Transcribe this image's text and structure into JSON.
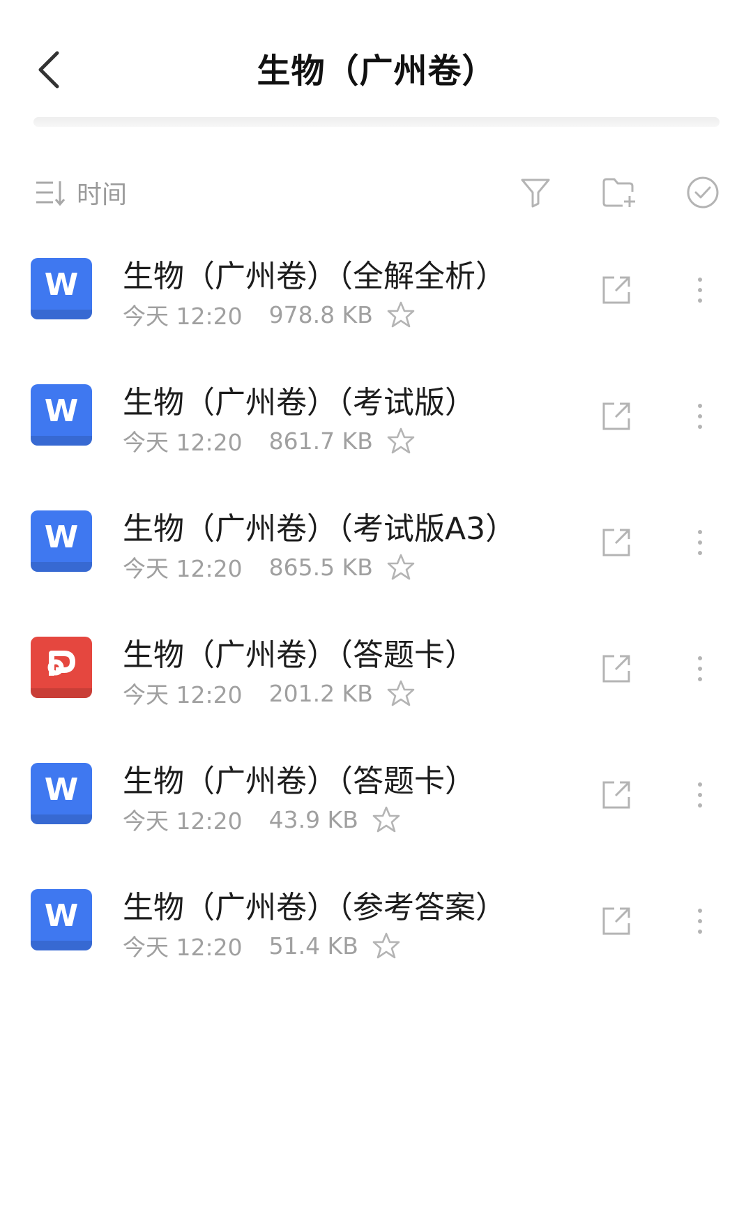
{
  "header": {
    "title": "生物（广州卷）"
  },
  "toolbar": {
    "sort_label": "时间"
  },
  "files": [
    {
      "type": "word",
      "name": "生物（广州卷）（全解全析）",
      "date": "今天 12:20",
      "size": "978.8 KB"
    },
    {
      "type": "word",
      "name": "生物（广州卷）（考试版）",
      "date": "今天 12:20",
      "size": "861.7 KB"
    },
    {
      "type": "word",
      "name": "生物（广州卷）（考试版A3）",
      "date": "今天 12:20",
      "size": "865.5 KB"
    },
    {
      "type": "ppt",
      "name": "生物（广州卷）（答题卡）",
      "date": "今天 12:20",
      "size": "201.2 KB"
    },
    {
      "type": "word",
      "name": "生物（广州卷）（答题卡）",
      "date": "今天 12:20",
      "size": "43.9 KB"
    },
    {
      "type": "word",
      "name": "生物（广州卷）（参考答案）",
      "date": "今天 12:20",
      "size": "51.4 KB"
    }
  ],
  "icons": {
    "word_letter": "W"
  },
  "colors": {
    "word": "#3f78f0",
    "ppt": "#e5473f",
    "icon_gray": "#b4b4b4"
  }
}
